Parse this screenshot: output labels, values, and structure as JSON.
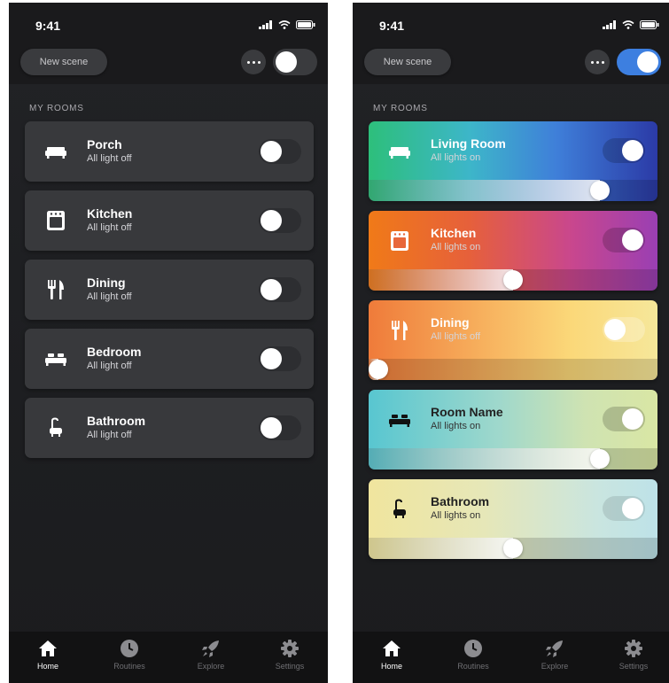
{
  "status": {
    "time": "9:41"
  },
  "header": {
    "new_scene": "New scene"
  },
  "section_label": "MY ROOMS",
  "left_rooms": [
    {
      "name": "Porch",
      "status": "All light off",
      "icon": "sofa-icon"
    },
    {
      "name": "Kitchen",
      "status": "All light off",
      "icon": "oven-icon"
    },
    {
      "name": "Dining",
      "status": "All light off",
      "icon": "fork-knife-icon"
    },
    {
      "name": "Bedroom",
      "status": "All light off",
      "icon": "bed-icon"
    },
    {
      "name": "Bathroom",
      "status": "All light off",
      "icon": "bathtub-icon"
    }
  ],
  "right_rooms": [
    {
      "name": "Living Room",
      "status": "All lights on",
      "on": true,
      "brightness": 0.8
    },
    {
      "name": "Kitchen",
      "status": "All lights on",
      "on": true,
      "brightness": 0.5
    },
    {
      "name": "Dining",
      "status": "All lights off",
      "on": false,
      "brightness": 0.0
    },
    {
      "name": "Room Name",
      "status": "All lights on",
      "on": true,
      "brightness": 0.8
    },
    {
      "name": "Bathroom",
      "status": "All lights on",
      "on": true,
      "brightness": 0.5
    }
  ],
  "tabs": [
    {
      "label": "Home",
      "icon": "home-icon"
    },
    {
      "label": "Routines",
      "icon": "clock-icon"
    },
    {
      "label": "Explore",
      "icon": "rocket-icon"
    },
    {
      "label": "Settings",
      "icon": "gear-icon"
    }
  ],
  "colors": {
    "accent": "#3d7fe0",
    "background": "#1e1f22",
    "card": "#38393c"
  }
}
